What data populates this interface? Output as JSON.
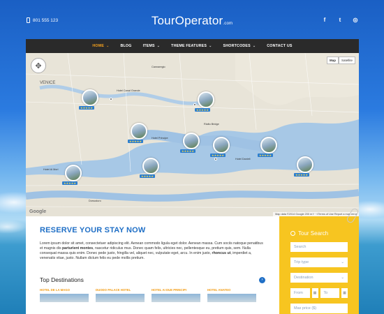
{
  "header": {
    "phone": "801 555 123",
    "logo_main": "TourOperator",
    "logo_suffix": ".com",
    "social": [
      "f",
      "t",
      "d"
    ]
  },
  "nav": {
    "items": [
      {
        "label": "HOME",
        "active": true,
        "dropdown": true
      },
      {
        "label": "BLOG",
        "dropdown": false
      },
      {
        "label": "ITEMS",
        "dropdown": true
      },
      {
        "label": "THEME FEATURES",
        "dropdown": true
      },
      {
        "label": "SHORTCODES",
        "dropdown": true
      },
      {
        "label": "CONTACT US",
        "dropdown": false
      }
    ]
  },
  "map": {
    "buttons": [
      "Map",
      "Satellite"
    ],
    "google": "Google",
    "footer": "Map data ©2014 Google   200 m ⟝⟞   Terms of Use   Report a map error",
    "labels": [
      "VENICE",
      "Hotel Canal Grande",
      "Hotel Principe",
      "Rialto Bridge",
      "Hotel Ai Mori",
      "Hotel Danieli",
      "Cannaregio",
      "Dorsoduro"
    ],
    "stars": "★★★★★"
  },
  "reserve": {
    "title": "RESERVE YOUR STAY NOW",
    "text_1": "Lorem ipsum dolor sit amet, consectetuer adipiscing elit. Aenean commodo ligula eget dolor. Aenean massa. Cum sociis natoque penatibus et magnis dis ",
    "bold_1": "parturient montes",
    "text_2": ", nascetur ridiculus mus. Donec quam felis, ultricies nec, pellentesque eu, pretium quis, sem. Nulla consequat massa quis enim. Donec pede justo, fringilla vel, aliquet nec, vulputate eget, arcu. In enim justo, ",
    "bold_2": "rhoncus ut",
    "text_3": ", imperdiet a, venenatis vitae, justo. Nullam dictum felis eu pede mollis pretium."
  },
  "destinations": {
    "title": "Top Destinations",
    "next_icon": "›",
    "items": [
      "HOTEL DE LA MAGO",
      "DUODO PALACE HOTEL",
      "HOTEL AI DUE PRINCIPI",
      "HOTEL ANATEO"
    ]
  },
  "tour_search": {
    "title": "Tour Search",
    "search_placeholder": "Search",
    "trip_type": "Trip type",
    "destination": "Destination",
    "from": "From",
    "to": "To",
    "max_price": "Max price ($)"
  },
  "colors": {
    "accent": "#1f6fc6",
    "nav_active": "#f6a21e",
    "search_bg": "#f7c520",
    "nav_bg": "#2a2a2a"
  }
}
